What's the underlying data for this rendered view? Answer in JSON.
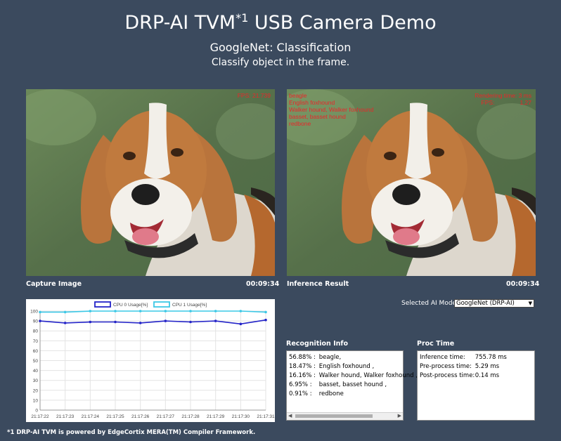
{
  "header": {
    "title_main": "DRP-AI TVM",
    "title_sup": "*1",
    "title_rest": " USB Camera Demo",
    "subtitle": "GoogleNet: Classification",
    "description": "Classify object in the frame."
  },
  "capture": {
    "fps_label": "FPS: 21.739",
    "caption": "Capture Image",
    "timestamp": "00:09:34"
  },
  "inference": {
    "labels": [
      "beagle",
      "English foxhound",
      "Walker hound, Walker foxhound",
      "basset, basset hound",
      "redbone"
    ],
    "render_time_label": "Rendering time: 3 ms",
    "fps_key": "FPS:",
    "fps_value": "1.27",
    "caption": "Inference Result",
    "timestamp": "00:09:34"
  },
  "model": {
    "label": "Selected AI Model",
    "selected": "GoogleNet (DRP-AI)"
  },
  "recognition": {
    "title": "Recognition Info",
    "rows": [
      {
        "pct": "56.88% :",
        "name": "beagle,"
      },
      {
        "pct": "18.47% :",
        "name": "English foxhound ,"
      },
      {
        "pct": "16.16% :",
        "name": "Walker hound, Walker foxhound ,"
      },
      {
        "pct": "6.95% :",
        "name": "basset, basset hound ,"
      },
      {
        "pct": "0.91% :",
        "name": "redbone"
      }
    ]
  },
  "proc": {
    "title": "Proc Time",
    "rows": [
      {
        "key": "Inference time:",
        "value": "755.78 ms"
      },
      {
        "key": "Pre-process time:",
        "value": "5.29 ms"
      },
      {
        "key": "Post-process time:",
        "value": "0.14 ms"
      }
    ]
  },
  "footnote": "*1 DRP-AI TVM is powered by EdgeCortix MERA(TM) Compiler Framework.",
  "colors": {
    "background": "#3b4a5e",
    "overlay_text": "#e8272a",
    "cpu0": "#2424c8",
    "cpu1": "#3cc8e6"
  },
  "chart_data": {
    "type": "line",
    "x": [
      "21:17:22",
      "21:17:23",
      "21:17:24",
      "21:17:25",
      "21:17:26",
      "21:17:27",
      "21:17:28",
      "21:17:29",
      "21:17:30",
      "21:17:31"
    ],
    "series": [
      {
        "name": "CPU 0 Usage[%]",
        "color": "#2424c8",
        "values": [
          90,
          88,
          89,
          89,
          88,
          90,
          89,
          90,
          87,
          91
        ]
      },
      {
        "name": "CPU 1 Usage[%]",
        "color": "#3cc8e6",
        "values": [
          99,
          99,
          100,
          100,
          100,
          100,
          100,
          100,
          100,
          99
        ]
      }
    ],
    "ylim": [
      0,
      100
    ],
    "yticks": [
      0,
      10,
      20,
      30,
      40,
      50,
      60,
      70,
      80,
      90,
      100
    ],
    "grid": true,
    "legend": "top"
  }
}
